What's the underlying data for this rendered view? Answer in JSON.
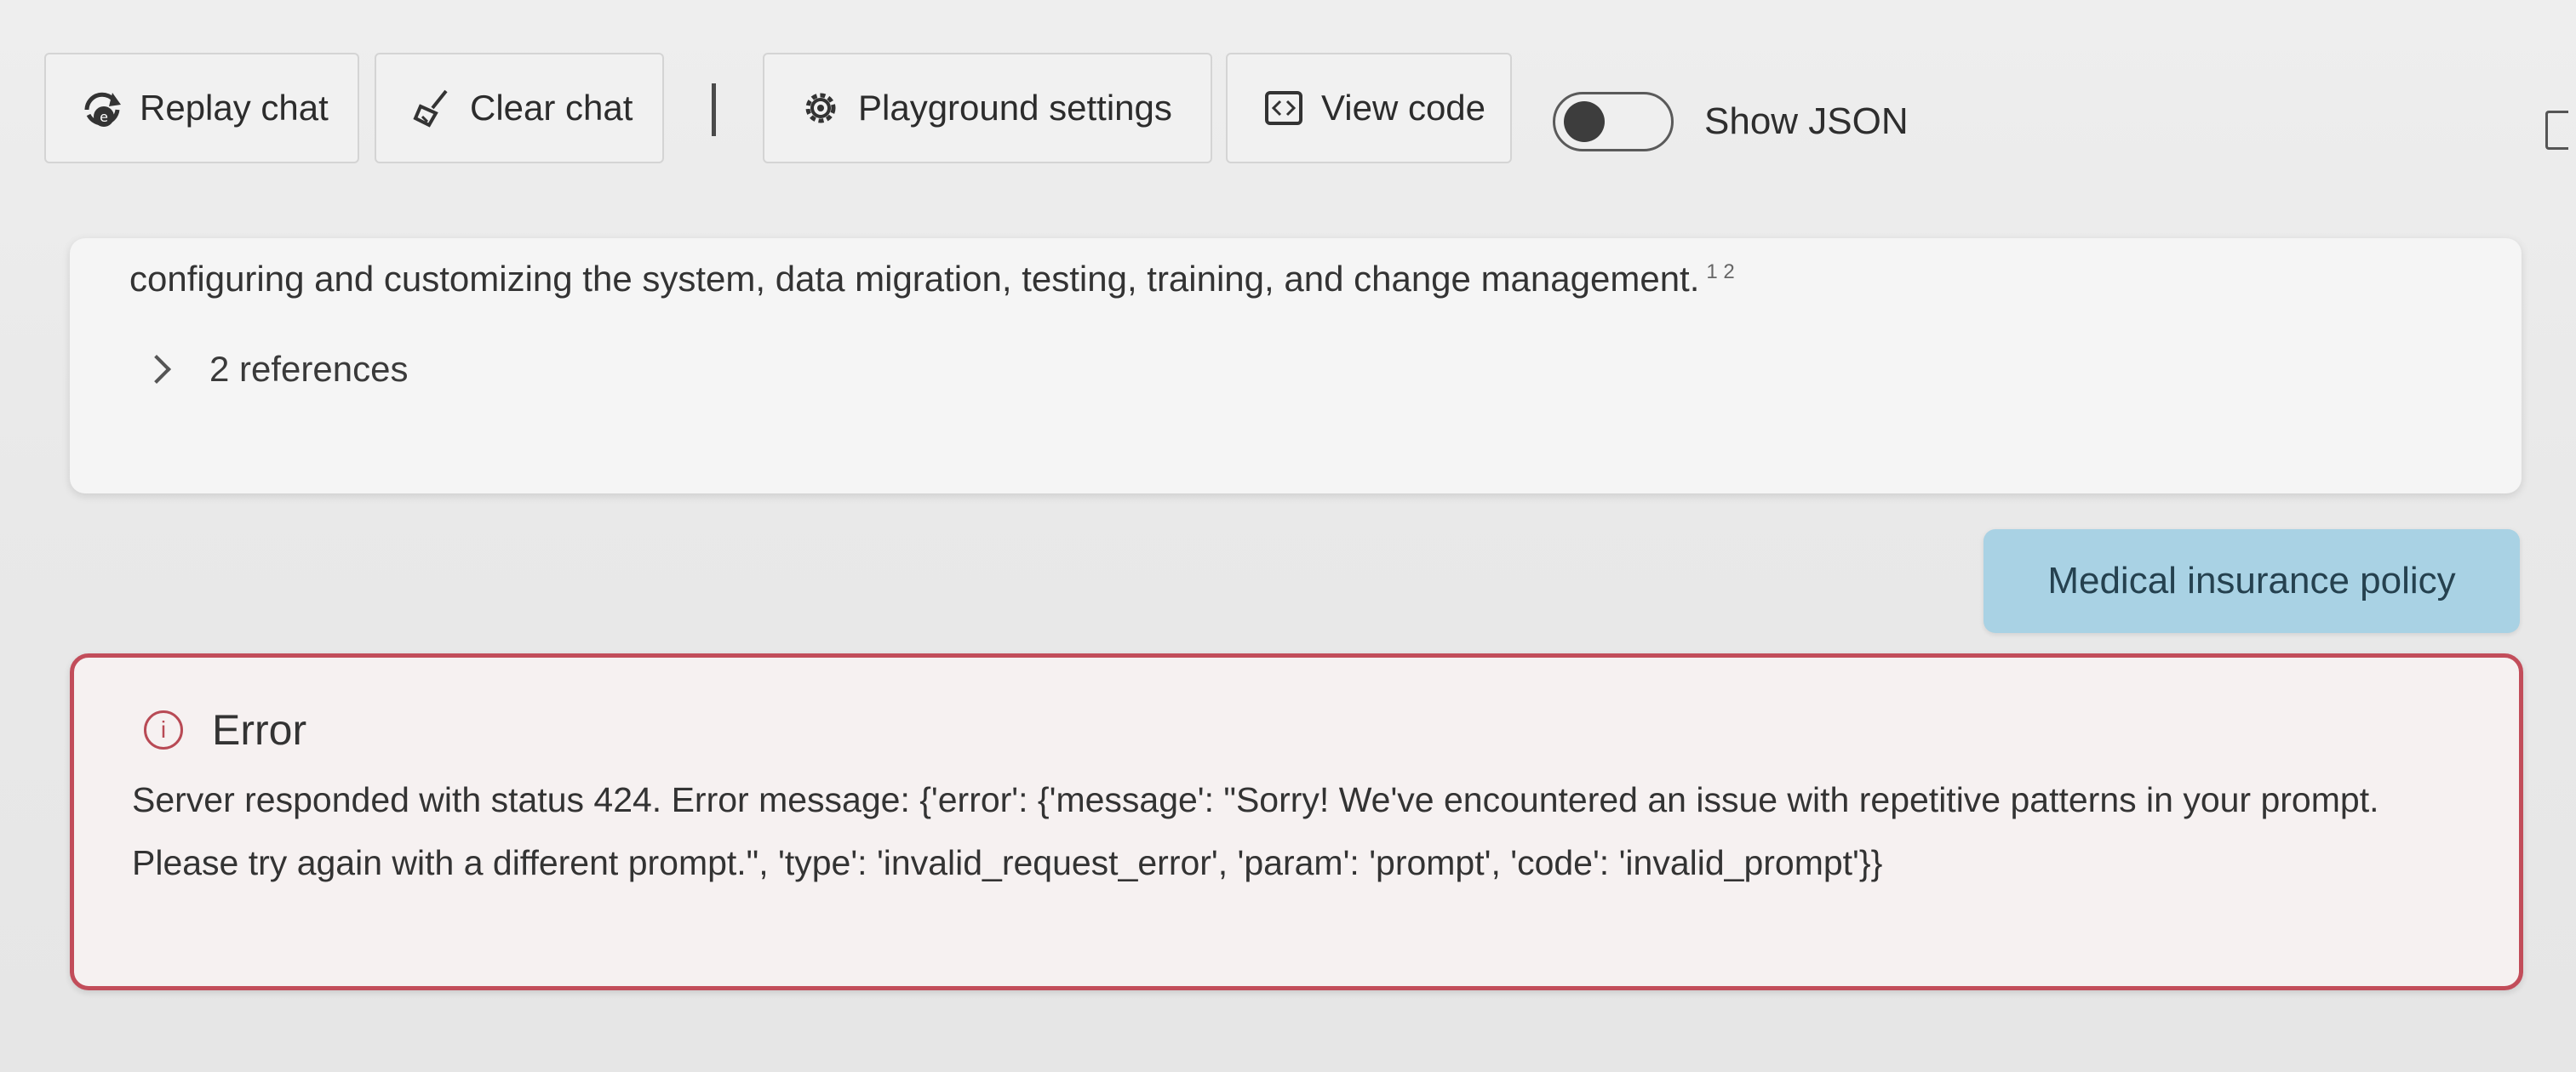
{
  "toolbar": {
    "replay_label": "Replay chat",
    "clear_label": "Clear chat",
    "settings_label": "Playground settings",
    "view_code_label": "View code",
    "show_json_label": "Show JSON",
    "show_json_on": false
  },
  "chat": {
    "assistant_text": "configuring and customizing the system, data migration, testing, training, and change management.",
    "assistant_citation": "1 2",
    "references_label": "2 references",
    "user_message": "Medical insurance policy",
    "error": {
      "title": "Error",
      "message": "Server responded with status 424. Error message: {'error': {'message': \"Sorry! We've encountered an issue with repetitive patterns in your prompt. Please try again with a different prompt.\", 'type': 'invalid_request_error', 'param': 'prompt', 'code': 'invalid_prompt'}}"
    }
  },
  "colors": {
    "user_bubble": "#a9d2e4",
    "error_border": "#c24d5a",
    "card_bg": "#f5f5f5"
  },
  "icons": {
    "replay": "replay-icon",
    "clear": "broom-icon",
    "settings": "gear-icon",
    "view_code": "code-icon",
    "references": "chevron-right-icon",
    "error": "info-icon"
  }
}
